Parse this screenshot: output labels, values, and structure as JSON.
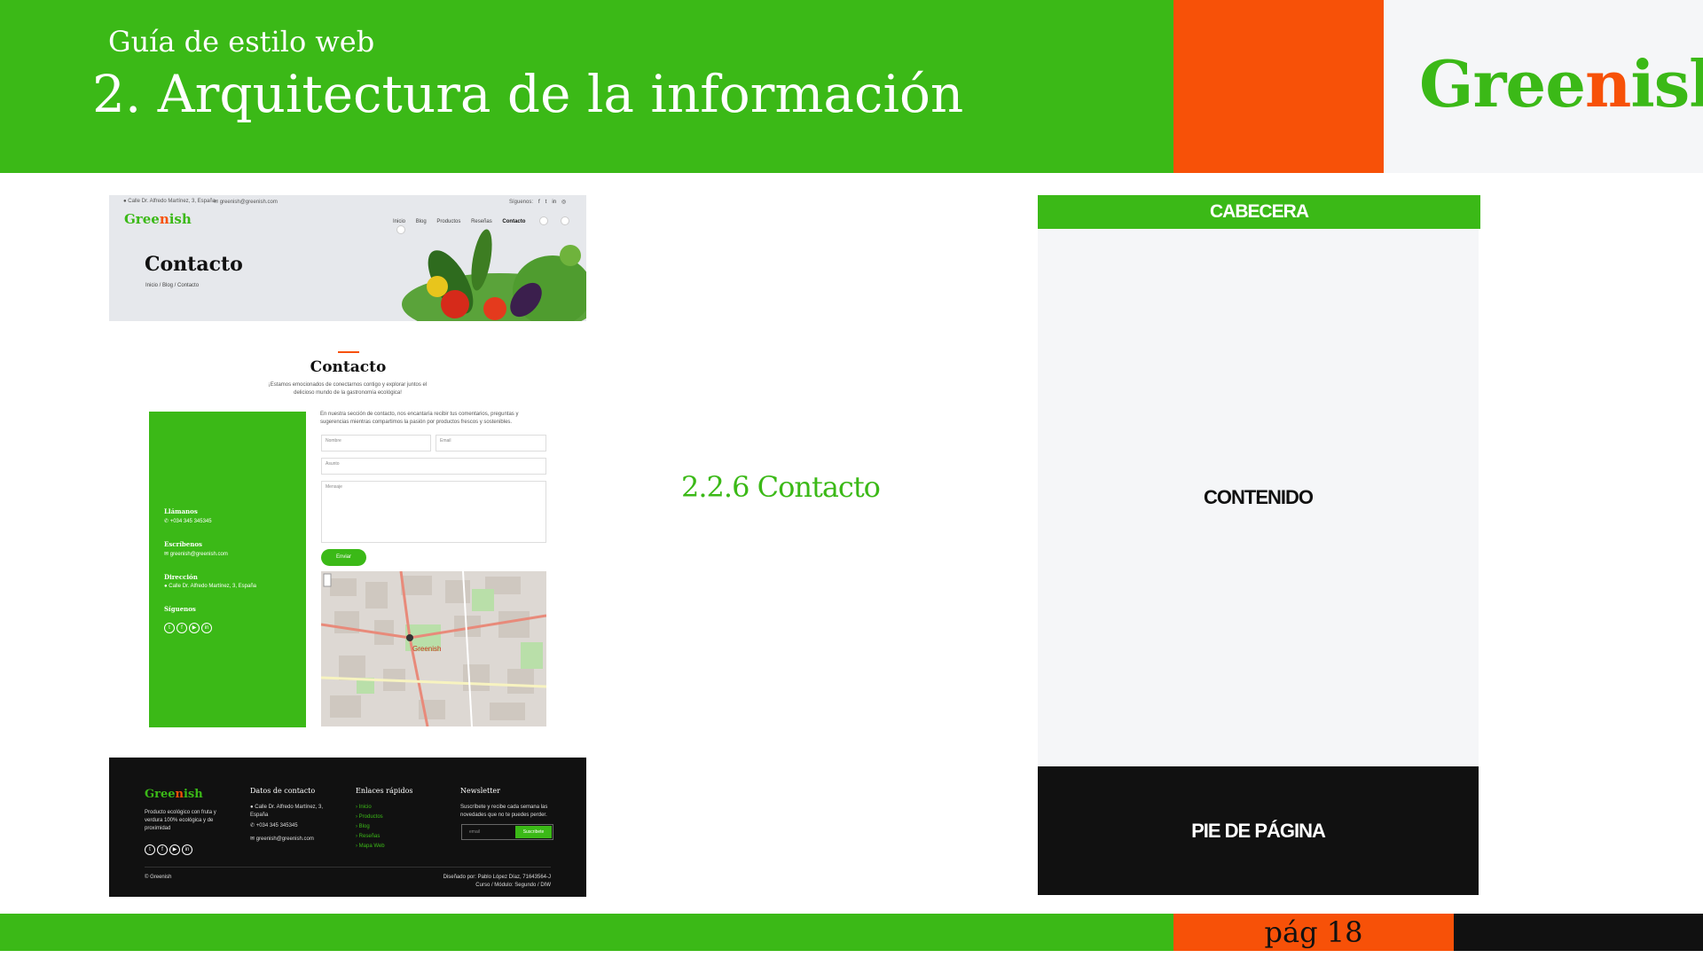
{
  "header": {
    "subtitle": "Guía de estilo web",
    "title": "2. Arquitectura de la información",
    "brand_part1": "Gree",
    "brand_part2": "n",
    "brand_part3": "ish"
  },
  "colors": {
    "green": "#3bb917",
    "orange": "#f75108",
    "dark": "#111111",
    "light": "#f5f6f8"
  },
  "mockup": {
    "topbar": {
      "address": "Calle Dr. Alfredo Martínez, 3, España",
      "email": "greenish@greenish.com",
      "follow_label": "Síguenos:"
    },
    "logo_part1": "Gree",
    "logo_part2": "n",
    "logo_part3": "ish",
    "nav": [
      "Inicio",
      "Blog",
      "Productos",
      "Reseñas",
      "Contacto"
    ],
    "hero_title": "Contacto",
    "breadcrumb": "Inicio  /  Blog  /  Contacto",
    "section_title": "Contacto",
    "section_desc": "¡Estamos emocionados de conectarnos contigo y explorar juntos el delicioso mundo de la gastronomía ecológica!",
    "info": {
      "call_label": "Llámanos",
      "call_value": "+034 345 345345",
      "write_label": "Escríbenos",
      "write_value": "greenish@greenish.com",
      "address_label": "Dirección",
      "address_value": "Calle Dr. Alfredo Martínez, 3, España",
      "follow_label": "Síguenos"
    },
    "form": {
      "intro": "En nuestra sección de contacto, nos encantaría recibir tus comentarios, preguntas y sugerencias mientras compartimos la pasión por productos frescos y sostenibles.",
      "name_placeholder": "Nombre",
      "email_placeholder": "Email",
      "subject_placeholder": "Asunto",
      "message_placeholder": "Mensaje",
      "send_label": "Enviar"
    },
    "map_label": "Greenish",
    "footer": {
      "logo_part1": "Gree",
      "logo_part2": "n",
      "logo_part3": "ish",
      "about": "Producto ecológico con fruta y verdura 100% ecológica y de proximidad",
      "contact_heading": "Datos de contacto",
      "contact_address": "Calle Dr. Alfredo Martínez, 3, España",
      "contact_phone": "+034 345 345345",
      "contact_email": "greenish@greenish.com",
      "links_heading": "Enlaces rápidos",
      "links": [
        "Inicio",
        "Productos",
        "Blog",
        "Reseñas",
        "Mapa Web"
      ],
      "newsletter_heading": "Newsletter",
      "newsletter_text": "Suscríbete y recibe cada semana las novedades que no te puedes perder.",
      "newsletter_placeholder": "email",
      "subscribe_label": "Suscribete",
      "copyright": "© Greenish",
      "credits_line1": "Diseñado por: Pablo López Díaz, 71643564-J",
      "credits_line2": "Curso / Módulo: Segundo / DIW"
    }
  },
  "section_label": "2.2.6 Contacto",
  "wireframe": {
    "header": "CABECERA",
    "content": "CONTENIDO",
    "footer": "PIE DE PÁGINA"
  },
  "page_number": "pág 18"
}
